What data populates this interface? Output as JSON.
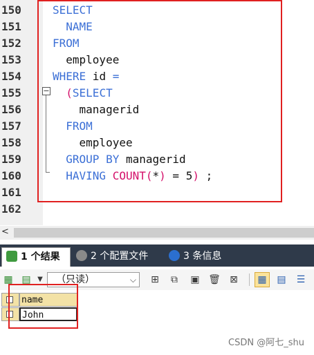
{
  "editor": {
    "line_numbers": [
      "150",
      "151",
      "152",
      "153",
      "154",
      "155",
      "156",
      "157",
      "158",
      "159",
      "160",
      "161",
      "162"
    ],
    "lines": [
      {
        "tokens": [
          {
            "t": "SELECT",
            "c": "kw"
          }
        ]
      },
      {
        "tokens": [
          {
            "t": "  NAME",
            "c": "kw"
          }
        ]
      },
      {
        "tokens": [
          {
            "t": "FROM",
            "c": "kw"
          }
        ]
      },
      {
        "tokens": [
          {
            "t": "  employee",
            "c": "plain"
          }
        ]
      },
      {
        "tokens": [
          {
            "t": "WHERE",
            "c": "kw"
          },
          {
            "t": " id ",
            "c": "plain"
          },
          {
            "t": "=",
            "c": "kw"
          }
        ]
      },
      {
        "tokens": [
          {
            "t": "  ",
            "c": "plain"
          },
          {
            "t": "(",
            "c": "fn"
          },
          {
            "t": "SELECT",
            "c": "kw"
          }
        ]
      },
      {
        "tokens": [
          {
            "t": "    managerid",
            "c": "plain"
          }
        ]
      },
      {
        "tokens": [
          {
            "t": "  FROM",
            "c": "kw"
          }
        ]
      },
      {
        "tokens": [
          {
            "t": "    employee",
            "c": "plain"
          }
        ]
      },
      {
        "tokens": [
          {
            "t": "  GROUP BY",
            "c": "kw"
          },
          {
            "t": " managerid",
            "c": "plain"
          }
        ]
      },
      {
        "tokens": [
          {
            "t": "  HAVING ",
            "c": "kw"
          },
          {
            "t": "COUNT",
            "c": "fn"
          },
          {
            "t": "(",
            "c": "fn"
          },
          {
            "t": "*",
            "c": "plain"
          },
          {
            "t": ")",
            "c": "fn"
          },
          {
            "t": " = 5",
            "c": "plain"
          },
          {
            "t": ")",
            "c": "fn"
          },
          {
            "t": " ;",
            "c": "plain"
          }
        ]
      },
      {
        "tokens": []
      },
      {
        "tokens": []
      }
    ],
    "fold_glyph": "−"
  },
  "scrollbar": {
    "left_arrow": "<"
  },
  "tabs": [
    {
      "label": "1 个结果",
      "icon": "table-result-icon",
      "active": true
    },
    {
      "label": "2 个配置文件",
      "icon": "profile-icon",
      "active": false
    },
    {
      "label": "3 条信息",
      "icon": "info-icon",
      "active": false
    }
  ],
  "toolbar": {
    "mode_select_value": "（只读）",
    "caret": "⌵",
    "buttons": [
      "grid-export-icon",
      "grid-options-icon",
      "add-row-icon",
      "duplicate-row-icon",
      "save-icon",
      "delete-row-icon",
      "discard-icon"
    ],
    "view_buttons": [
      "grid-view-icon",
      "form-view-icon",
      "text-view-icon"
    ]
  },
  "result_grid": {
    "columns": [
      "name"
    ],
    "rows": [
      [
        "John"
      ]
    ]
  },
  "colors": {
    "keyword": "#3b6fd6",
    "function": "#d4106a",
    "highlight_box": "#e02020",
    "tab_bar": "#2f3a4a"
  },
  "watermark": "CSDN @阿七_shu"
}
